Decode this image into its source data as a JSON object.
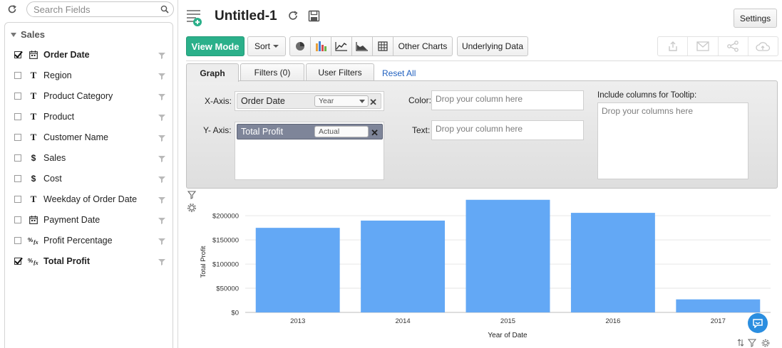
{
  "sidebar": {
    "search_placeholder": "Search Fields",
    "group_label": "Sales",
    "fields": [
      {
        "label": "Order Date",
        "type": "date",
        "checked": true,
        "bold": true
      },
      {
        "label": "Region",
        "type": "text",
        "checked": false,
        "bold": false
      },
      {
        "label": "Product Category",
        "type": "text",
        "checked": false,
        "bold": false
      },
      {
        "label": "Product",
        "type": "text",
        "checked": false,
        "bold": false
      },
      {
        "label": "Customer Name",
        "type": "text",
        "checked": false,
        "bold": false
      },
      {
        "label": "Sales",
        "type": "currency",
        "checked": false,
        "bold": false
      },
      {
        "label": "Cost",
        "type": "currency",
        "checked": false,
        "bold": false
      },
      {
        "label": "Weekday of Order Date",
        "type": "text",
        "checked": false,
        "bold": false
      },
      {
        "label": "Payment Date",
        "type": "date",
        "checked": false,
        "bold": false
      },
      {
        "label": "Profit Percentage",
        "type": "formula",
        "checked": false,
        "bold": false
      },
      {
        "label": "Total Profit",
        "type": "formula",
        "checked": true,
        "bold": true
      }
    ]
  },
  "header": {
    "title": "Untitled-1",
    "settings_label": "Settings"
  },
  "toolbar": {
    "view_mode_label": "View Mode",
    "sort_label": "Sort",
    "other_charts_label": "Other Charts",
    "underlying_data_label": "Underlying Data",
    "chart_type_icons": [
      "pie-chart-icon",
      "bar-chart-icon",
      "line-chart-icon",
      "area-chart-icon",
      "table-icon"
    ],
    "share_icons": [
      "export-icon",
      "email-icon",
      "share-icon",
      "publish-icon"
    ]
  },
  "tabs": {
    "graph": "Graph",
    "filters": "Filters  (0)",
    "user_filters": "User Filters",
    "reset_all": "Reset All"
  },
  "config": {
    "x_axis_label": "X-Axis:",
    "y_axis_label": "Y- Axis:",
    "color_label": "Color:",
    "text_label": "Text:",
    "tooltip_label": "Include columns for Tooltip:",
    "x_field": "Order Date",
    "x_agg": "Year",
    "y_field": "Total Profit",
    "y_agg": "Actual",
    "color_placeholder": "Drop your column here",
    "text_placeholder": "Drop your column here",
    "tooltip_placeholder": "Drop your columns here"
  },
  "colors": {
    "accent_green": "#2bb08a",
    "bar_blue": "#63a8f5",
    "link_blue": "#1f5fbf",
    "pill_blue_gray": "#7e8599"
  },
  "chart_data": {
    "type": "bar",
    "categories": [
      "2013",
      "2014",
      "2015",
      "2016",
      "2017"
    ],
    "values": [
      175000,
      190000,
      233000,
      206000,
      27000
    ],
    "xlabel": "Year of Date",
    "ylabel": "Total Profit",
    "ylim": [
      0,
      240000
    ],
    "yticks": [
      0,
      50000,
      100000,
      150000,
      200000
    ],
    "ytick_labels": [
      "$0",
      "$50000",
      "$100000",
      "$150000",
      "$200000"
    ],
    "grid": true,
    "bar_color": "#63a8f5"
  }
}
